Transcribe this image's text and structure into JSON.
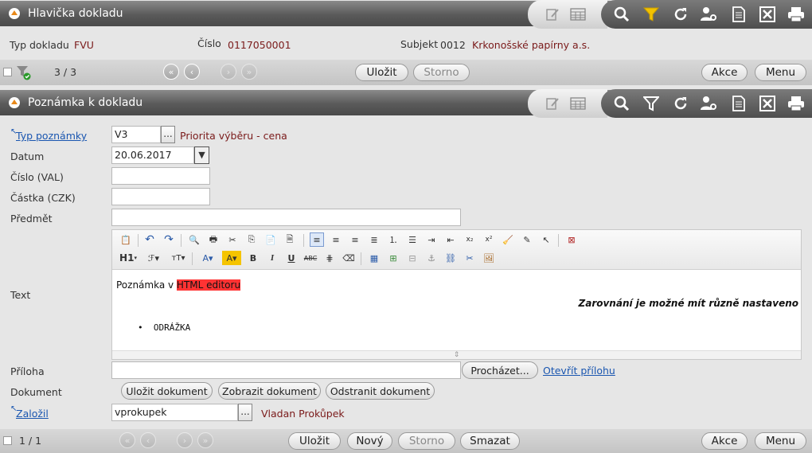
{
  "header1": {
    "title": "Hlavička dokladu"
  },
  "doc": {
    "type_label": "Typ dokladu",
    "type_value": "FVU",
    "number_label": "Číslo",
    "number_value": "0117050001",
    "subject_label": "Subjekt",
    "subject_code": "0012",
    "subject_name": "Krkonošské papírny a.s."
  },
  "bar1": {
    "counter": "3 / 3",
    "save": "Uložit",
    "cancel": "Storno",
    "actions": "Akce",
    "menu": "Menu"
  },
  "header2": {
    "title": "Poznámka k dokladu"
  },
  "form": {
    "note_type_label": "Typ poznámky",
    "note_type_value": "V3",
    "note_type_desc": "Priorita výběru - cena",
    "date_label": "Datum",
    "date_value": "20.06.2017",
    "number_label": "Číslo (VAL)",
    "number_value": "",
    "amount_label": "Částka (CZK)",
    "amount_value": "",
    "subject_label": "Předmět",
    "subject_value": "",
    "text_label": "Text",
    "attachment_label": "Příloha",
    "attachment_value": "",
    "browse": "Procházet...",
    "open_attachment": "Otevřít přílohu",
    "document_label": "Dokument",
    "doc_save": "Uložit dokument",
    "doc_show": "Zobrazit dokument",
    "doc_remove": "Odstranit dokument",
    "created_label": "Založil",
    "created_value": "vprokupek",
    "created_name": "Vladan Prokůpek"
  },
  "editor": {
    "line1_prefix": "Poznámka v ",
    "line1_highlight": "HTML editoru",
    "line2": "Zarovnání je možné mít různě nastaveno",
    "bullet": "ODRÁŽKA",
    "heading_btn": "H1",
    "highlight_color": "#ff3333"
  },
  "bar2": {
    "counter": "1 / 1",
    "save": "Uložit",
    "new": "Nový",
    "cancel": "Storno",
    "delete": "Smazat",
    "actions": "Akce",
    "menu": "Menu"
  },
  "colors": {
    "accent": "#e8891a",
    "value": "#7a1a1a",
    "link": "#1a56b0"
  }
}
